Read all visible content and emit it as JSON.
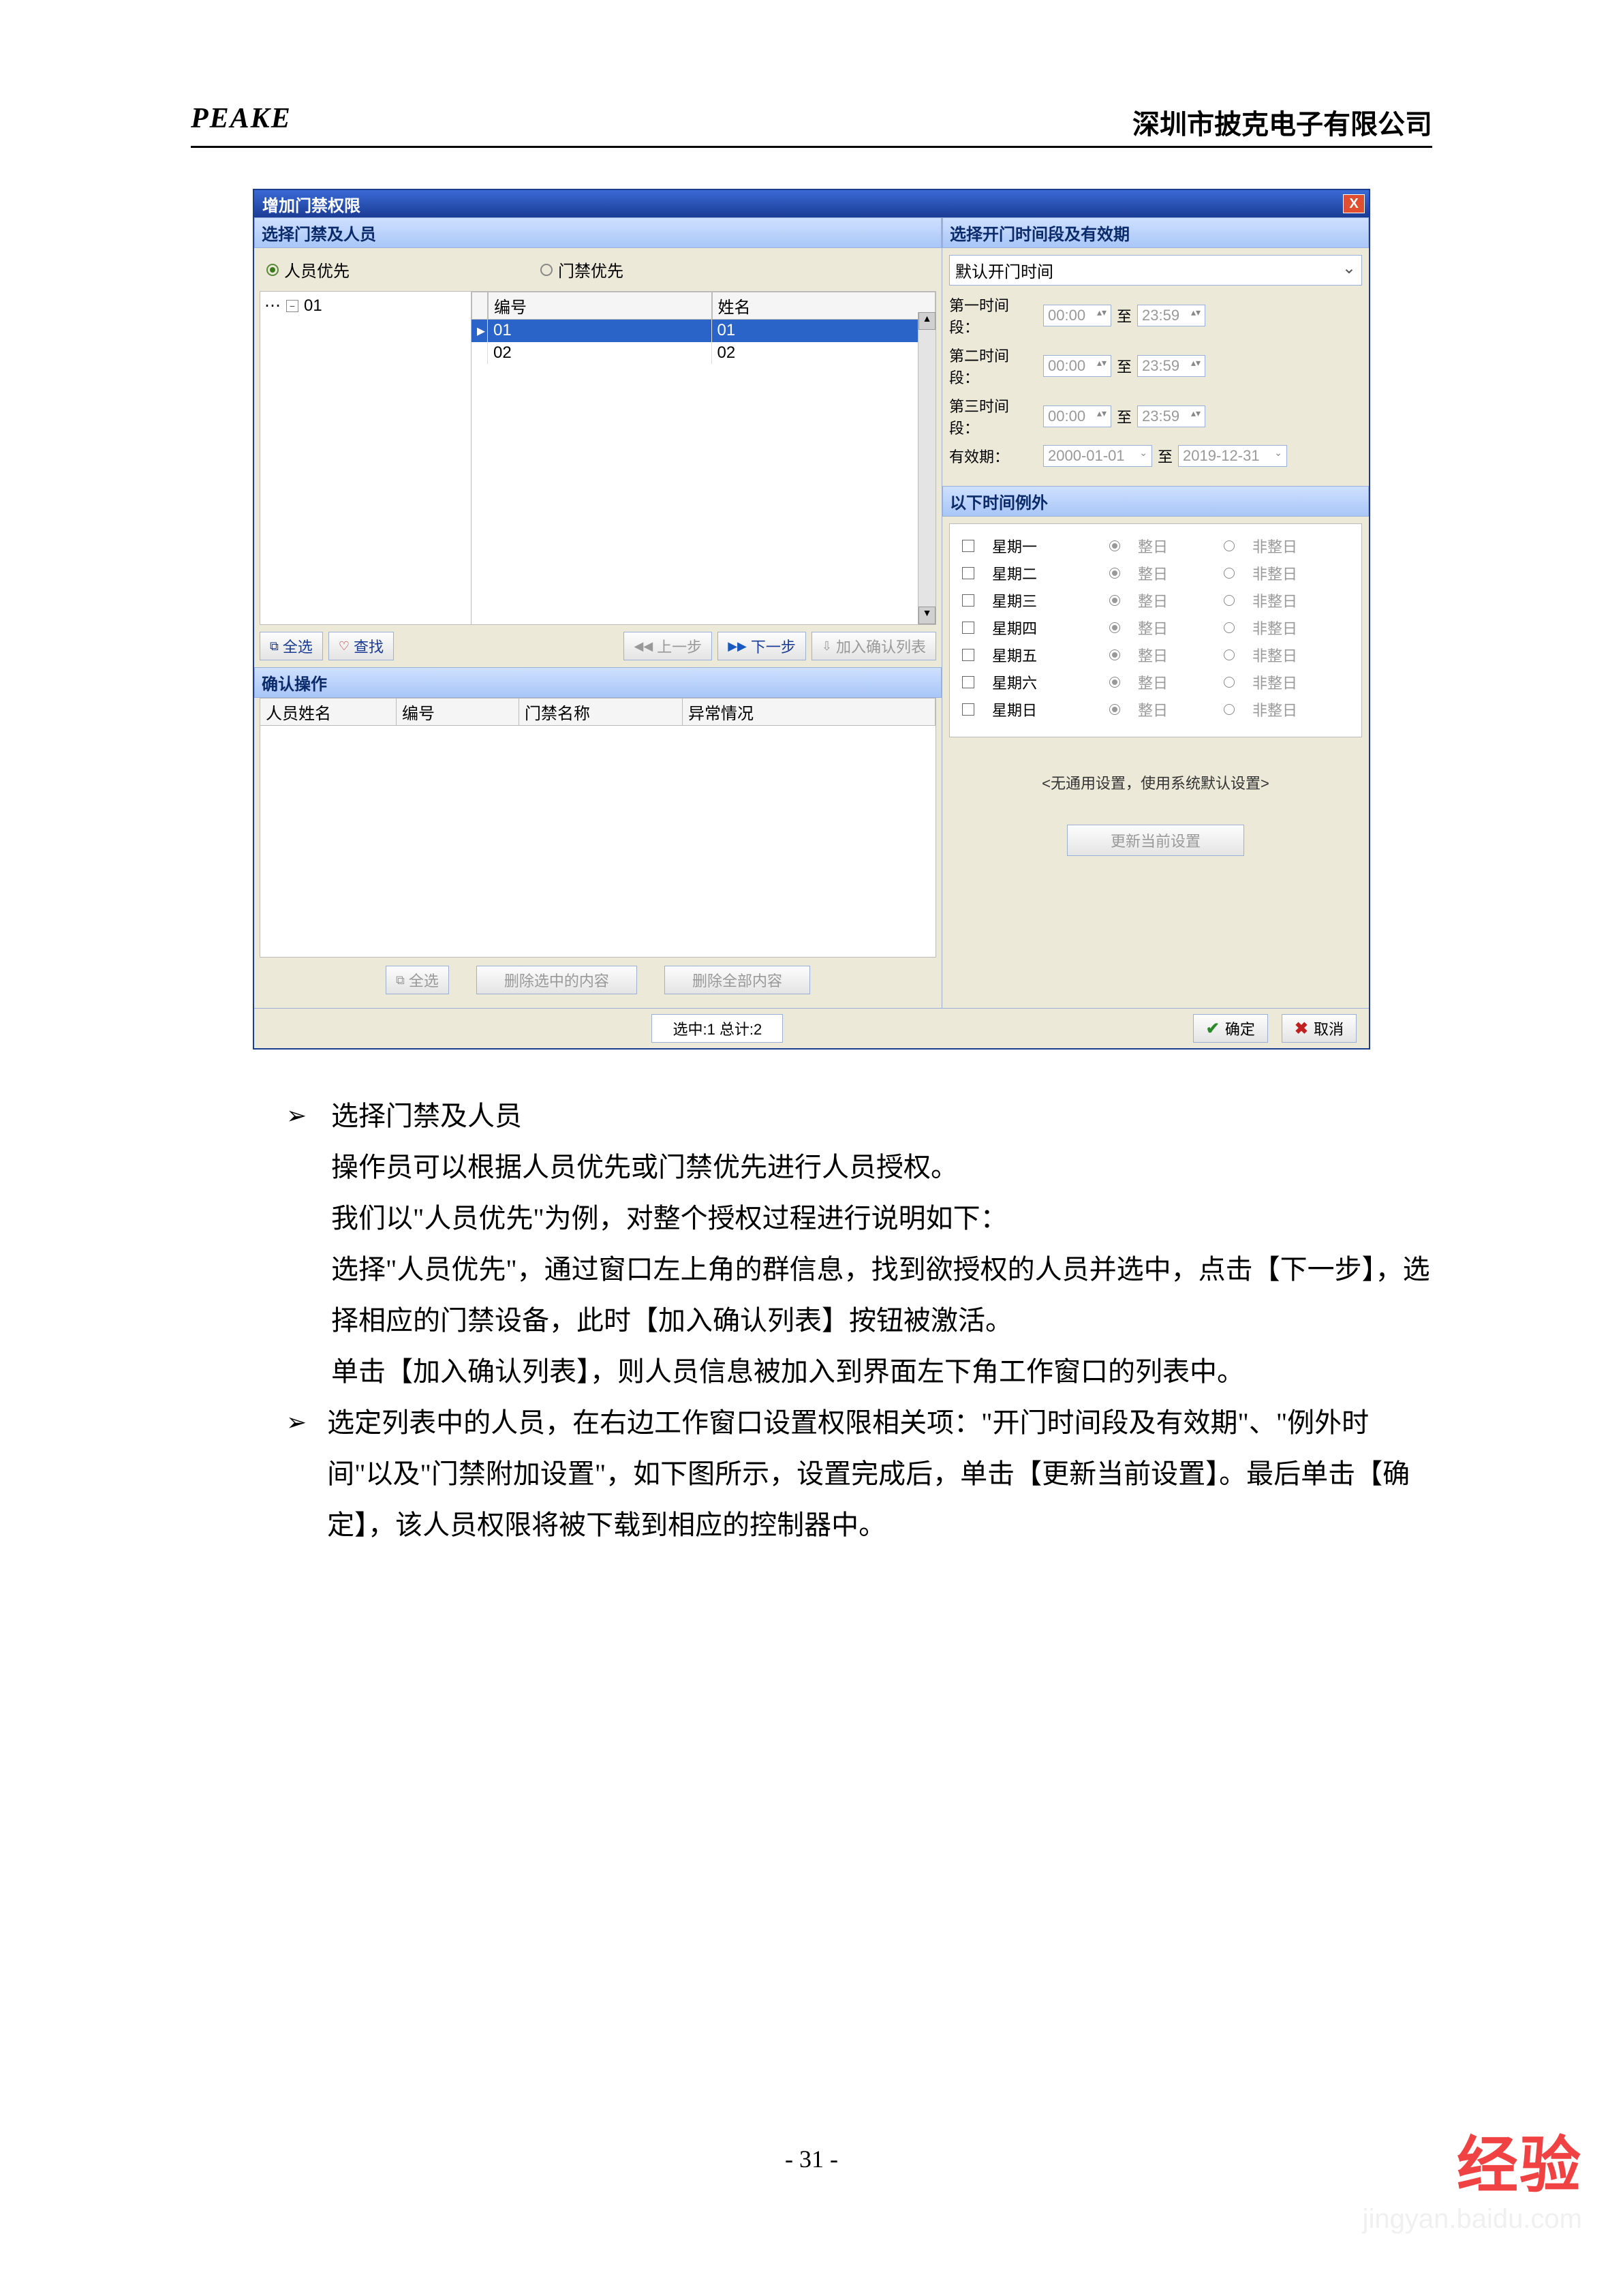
{
  "header": {
    "brand": "PEAKE",
    "company": "深圳市披克电子有限公司"
  },
  "dialog": {
    "title": "增加门禁权限",
    "close": "X",
    "left_section": "选择门禁及人员",
    "right_section": "选择开门时间段及有效期",
    "radio1": "人员优先",
    "radio2": "门禁优先",
    "tree_root": "01",
    "grid_hdr1": "编号",
    "grid_hdr2": "姓名",
    "rows": [
      {
        "id": "01",
        "name": "01"
      },
      {
        "id": "02",
        "name": "02"
      }
    ],
    "btn_selectall": "全选",
    "btn_search": "查找",
    "btn_prev": "上一步",
    "btn_next": "下一步",
    "btn_addlist": "加入确认列表",
    "confirm_title": "确认操作",
    "thdr1": "人员姓名",
    "thdr2": "编号",
    "thdr3": "门禁名称",
    "thdr4": "异常情况",
    "btn_selectall2": "全选",
    "btn_delsel": "删除选中的内容",
    "btn_delall": "删除全部内容",
    "status": "选中:1 总计:2",
    "ok": "确定",
    "cancel": "取消"
  },
  "right": {
    "dropdown": "默认开门时间",
    "t1": "第一时间段：",
    "t2": "第二时间段：",
    "t3": "第三时间段：",
    "start": "00:00",
    "to": "至",
    "end": "23:59",
    "validlabel": "有效期：",
    "validstart": "2000-01-01",
    "validend": "2019-12-31",
    "exc_title": "以下时间例外",
    "days": [
      "星期一",
      "星期二",
      "星期三",
      "星期四",
      "星期五",
      "星期六",
      "星期日"
    ],
    "whole": "整日",
    "notwhole": "非整日",
    "nogeneral": "<无通用设置，使用系统默认设置>",
    "update": "更新当前设置"
  },
  "doc": {
    "bullet1": "选择门禁及人员",
    "p1": "操作员可以根据人员优先或门禁优先进行人员授权。",
    "p2": "我们以\"人员优先\"为例，对整个授权过程进行说明如下：",
    "p3": "选择\"人员优先\"，通过窗口左上角的群信息，找到欲授权的人员并选中，点击【下一步】，选择相应的门禁设备，此时【加入确认列表】按钮被激活。",
    "p4": "单击【加入确认列表】，则人员信息被加入到界面左下角工作窗口的列表中。",
    "bullet2": "选定列表中的人员，在右边工作窗口设置权限相关项：\"开门时间段及有效期\"、\"例外时间\"以及\"门禁附加设置\"，如下图所示，设置完成后，单击【更新当前设置】。最后单击【确定】，该人员权限将被下载到相应的控制器中。"
  },
  "pagenum": "- 31 -",
  "watermark": {
    "brand": "Baidu",
    "cn": "经验",
    "url": "jingyan.baidu.com"
  }
}
